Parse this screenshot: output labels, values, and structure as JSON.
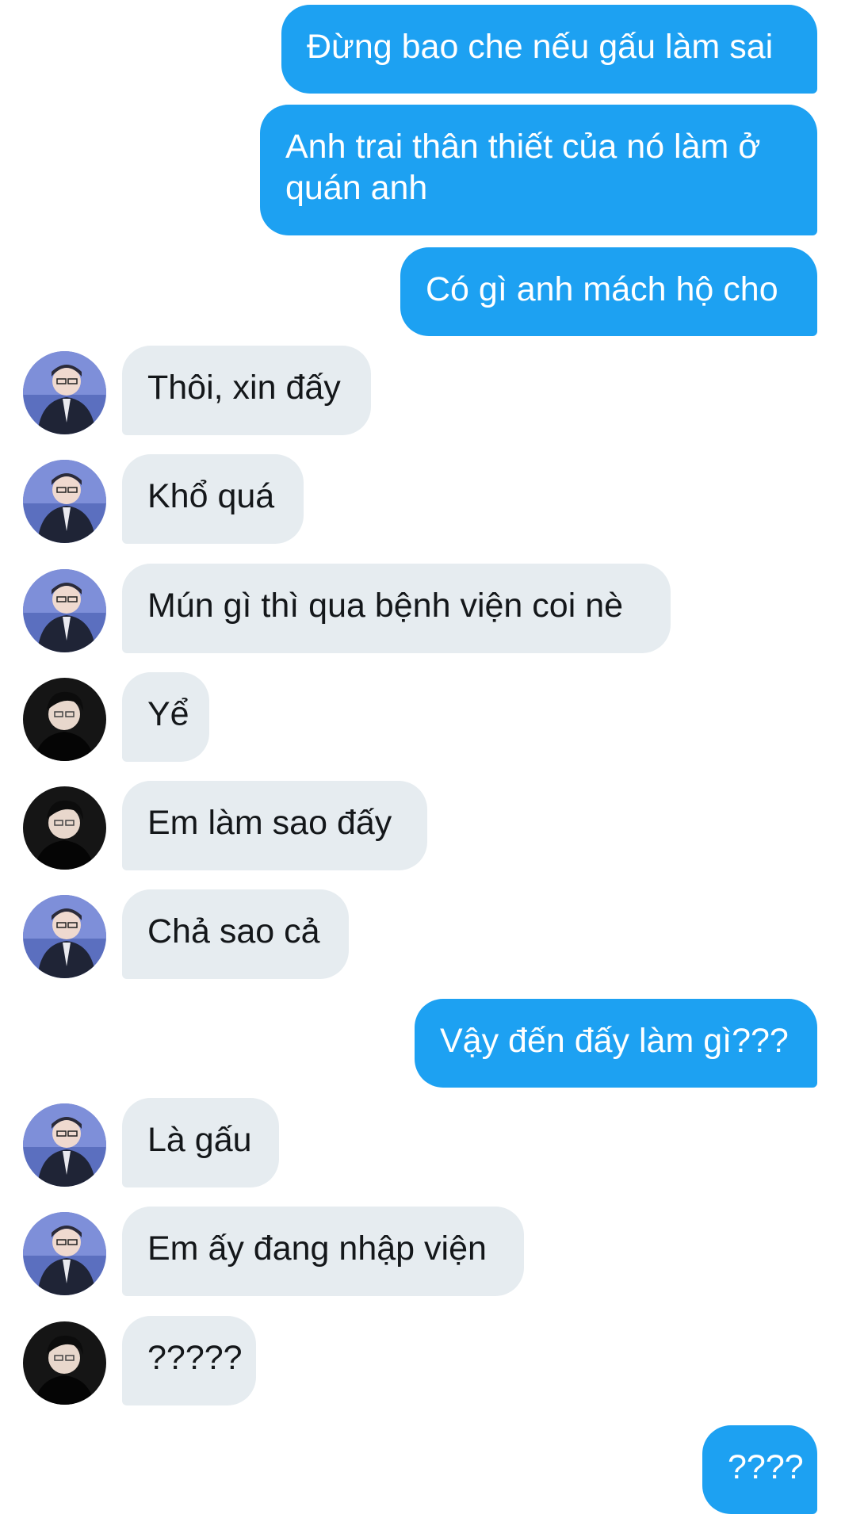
{
  "conversation": {
    "messages": [
      {
        "from": "me",
        "text": "Đừng bao che nếu gấu làm sai"
      },
      {
        "from": "me",
        "text": "Anh trai thân thiết của nó làm ở quán anh"
      },
      {
        "from": "me",
        "text": "Có gì anh mách hộ cho"
      },
      {
        "from": "contact_a",
        "text": "Thôi, xin đấy"
      },
      {
        "from": "contact_a",
        "text": "Khổ quá"
      },
      {
        "from": "contact_a",
        "text": "Mún gì thì qua bệnh viện coi nè"
      },
      {
        "from": "contact_b",
        "text": "Yể"
      },
      {
        "from": "contact_b",
        "text": "Em làm sao đấy"
      },
      {
        "from": "contact_a",
        "text": "Chả sao cả"
      },
      {
        "from": "me",
        "text": "Vậy đến đấy làm gì???"
      },
      {
        "from": "contact_a",
        "text": "Là gấu"
      },
      {
        "from": "contact_a",
        "text": "Em ấy đang nhập viện"
      },
      {
        "from": "contact_b",
        "text": "?????"
      },
      {
        "from": "me",
        "text": "????"
      }
    ]
  },
  "colors": {
    "outgoing_bubble": "#1da1f2",
    "incoming_bubble": "#e6ecf0",
    "outgoing_text": "#ffffff",
    "incoming_text": "#14171a"
  },
  "icons": {
    "contact_a_avatar": "avatar-photo-blue-background",
    "contact_b_avatar": "avatar-photo-dark-background"
  }
}
